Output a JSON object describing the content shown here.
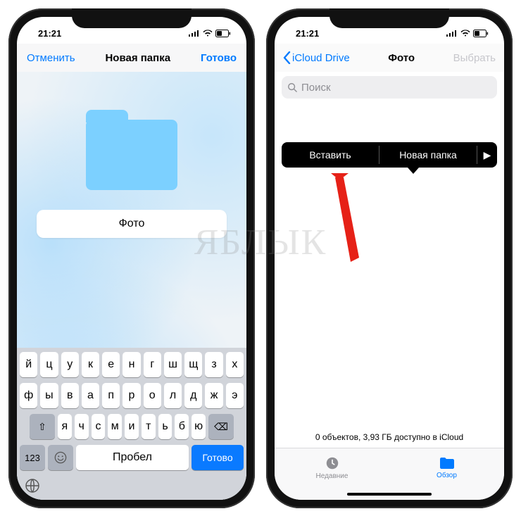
{
  "watermark": "ЯБЛЫК",
  "status": {
    "time": "21:21"
  },
  "left": {
    "cancel": "Отменить",
    "title": "Новая папка",
    "done": "Готово",
    "folder_name": "Фото",
    "keyboard": {
      "row1": [
        "й",
        "ц",
        "у",
        "к",
        "е",
        "н",
        "г",
        "ш",
        "щ",
        "з",
        "х"
      ],
      "row2": [
        "ф",
        "ы",
        "в",
        "а",
        "п",
        "р",
        "о",
        "л",
        "д",
        "ж",
        "э"
      ],
      "row3": [
        "я",
        "ч",
        "с",
        "м",
        "и",
        "т",
        "ь",
        "б",
        "ю"
      ],
      "shift_label": "⇧",
      "backspace_label": "⌫",
      "num_label": "123",
      "space_label": "Пробел",
      "return_label": "Готово"
    }
  },
  "right": {
    "back_label": "iCloud Drive",
    "title": "Фото",
    "select_label": "Выбрать",
    "search_placeholder": "Поиск",
    "context": {
      "paste": "Вставить",
      "new_folder": "Новая папка"
    },
    "footer": "0 объектов, 3,93 ГБ доступно в iCloud",
    "tabs": {
      "recents": "Недавние",
      "browse": "Обзор"
    }
  }
}
